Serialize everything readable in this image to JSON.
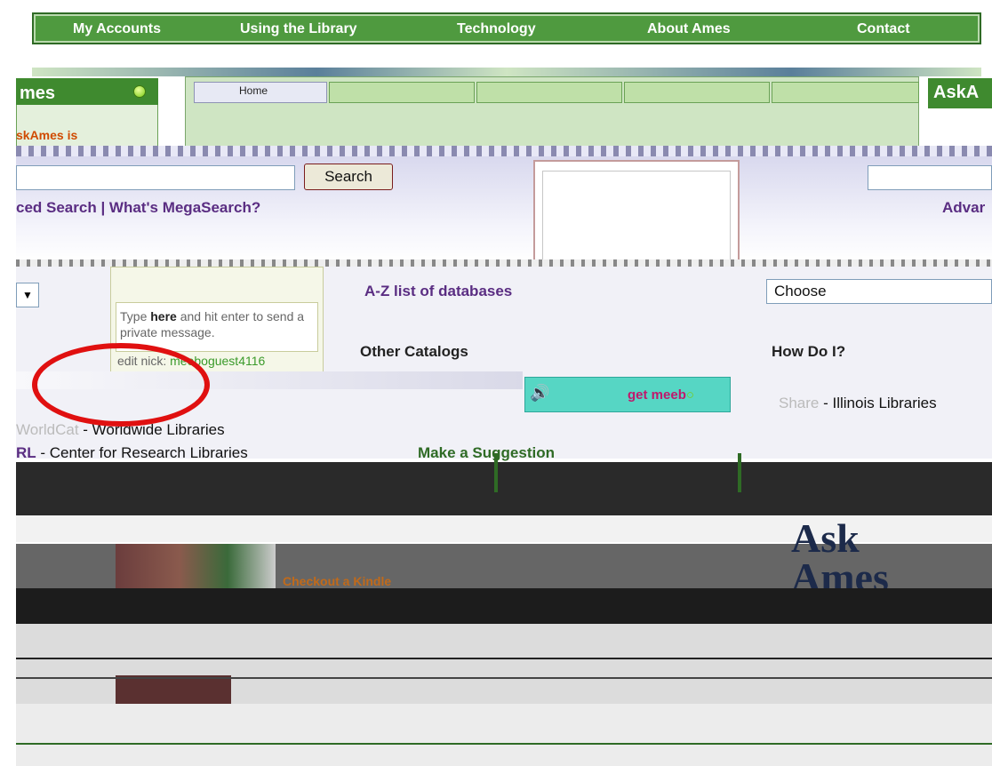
{
  "nav": {
    "items": [
      "My Accounts",
      "Using the Library",
      "Technology",
      "About Ames",
      "Contact"
    ]
  },
  "left_panel": {
    "title": "mes",
    "note": "skAmes is"
  },
  "right_panel": {
    "title": "AskA"
  },
  "tabs": {
    "home": "Home"
  },
  "search": {
    "button": "Search",
    "links": "ced Search | What's MegaSearch?",
    "right_link": "Advar"
  },
  "chat": {
    "message_bold": "here",
    "message_pre": "Type ",
    "message_post": " and hit enter to send a private message.",
    "nick_label": "edit nick: ",
    "nick_value": "meeboguest4116",
    "getmeeb": "get meeb"
  },
  "content": {
    "az_link": "A-Z list of databases",
    "choose": "Choose",
    "other_catalogs": "Other Catalogs",
    "how_do_i": "How Do I?",
    "share_faint": "Share",
    "share_text": " - Illinois Libraries",
    "worldwide_faint": "WorldCat",
    "worldwide_text": " - Worldwide Libraries",
    "crl_bold": "RL",
    "crl_text": " - Center for Research Libraries",
    "suggestion": "Make a Suggestion",
    "kindle": "Checkout a Kindle"
  },
  "logo": {
    "text_line1": "Ask",
    "text_line2": "Ames"
  },
  "colors": {
    "nav_green": "#4f9a3f",
    "link_purple": "#5a2d82",
    "annotation_red": "#e01010",
    "meebo_teal": "#56d6c4"
  }
}
